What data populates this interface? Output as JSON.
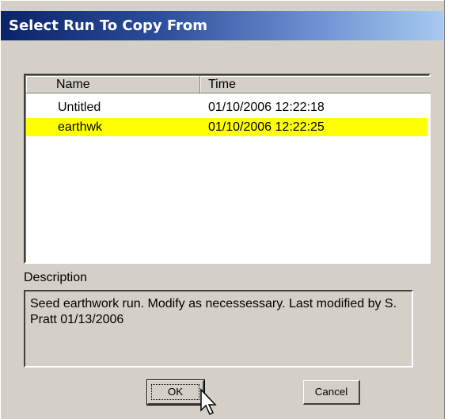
{
  "window": {
    "title": "Select Run To Copy From"
  },
  "list": {
    "columns": {
      "name": "Name",
      "time": "Time"
    },
    "rows": [
      {
        "name": "Untitled",
        "time": "01/10/2006 12:22:18",
        "selected": false
      },
      {
        "name": "earthwk",
        "time": "01/10/2006 12:22:25",
        "selected": true
      }
    ],
    "highlight_color": "#ffff00"
  },
  "description": {
    "label": "Description",
    "text": "Seed earthwork run.  Modify as necessessary.  Last modified by S. Pratt 01/13/2006"
  },
  "buttons": {
    "ok_label": "OK",
    "cancel_label": "Cancel"
  },
  "icons": {
    "cursor": "arrow-pointer-icon"
  },
  "colors": {
    "titlebar_start": "#0a246a",
    "titlebar_end": "#a6caf0",
    "dialog_bg": "#d4d0c8"
  }
}
